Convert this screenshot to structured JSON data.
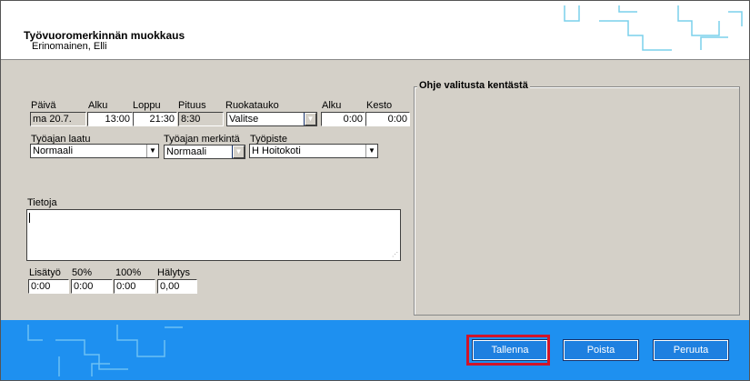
{
  "header": {
    "title": "Työvuoromerkinnän muokkaus",
    "subtitle": "Erinomainen, Elli"
  },
  "form": {
    "paiva_label": "Päivä",
    "paiva_value": "ma 20.7.",
    "alku_label": "Alku",
    "alku_value": "13:00",
    "loppu_label": "Loppu",
    "loppu_value": "21:30",
    "pituus_label": "Pituus",
    "pituus_value": "8:30",
    "ruokatauko_label": "Ruokatauko",
    "ruokatauko_value": "Valitse",
    "ruoka_alku_label": "Alku",
    "ruoka_alku_value": "0:00",
    "kesto_label": "Kesto",
    "kesto_value": "0:00",
    "tyoajan_laatu_label": "Työajan laatu",
    "tyoajan_laatu_value": "Normaali",
    "tyoajan_merkinta_label": "Työajan merkintä",
    "tyoajan_merkinta_value": "Normaali",
    "tyopiste_label": "Työpiste",
    "tyopiste_value": "H Hoitokoti",
    "tietoja_label": "Tietoja",
    "lisatyo_label": "Lisätyö",
    "lisatyo_value": "0:00",
    "p50_label": "50%",
    "p50_value": "0:00",
    "p100_label": "100%",
    "p100_value": "0:00",
    "halytys_label": "Hälytys",
    "halytys_value": "0,00"
  },
  "help": {
    "title": "Ohje valitusta kentästä"
  },
  "footer": {
    "save_label": "Tallenna",
    "delete_label": "Poista",
    "cancel_label": "Peruuta"
  },
  "colors": {
    "footer_bg": "#1e90f0",
    "button_bg": "#1e80e0",
    "highlight": "#d0142a"
  }
}
